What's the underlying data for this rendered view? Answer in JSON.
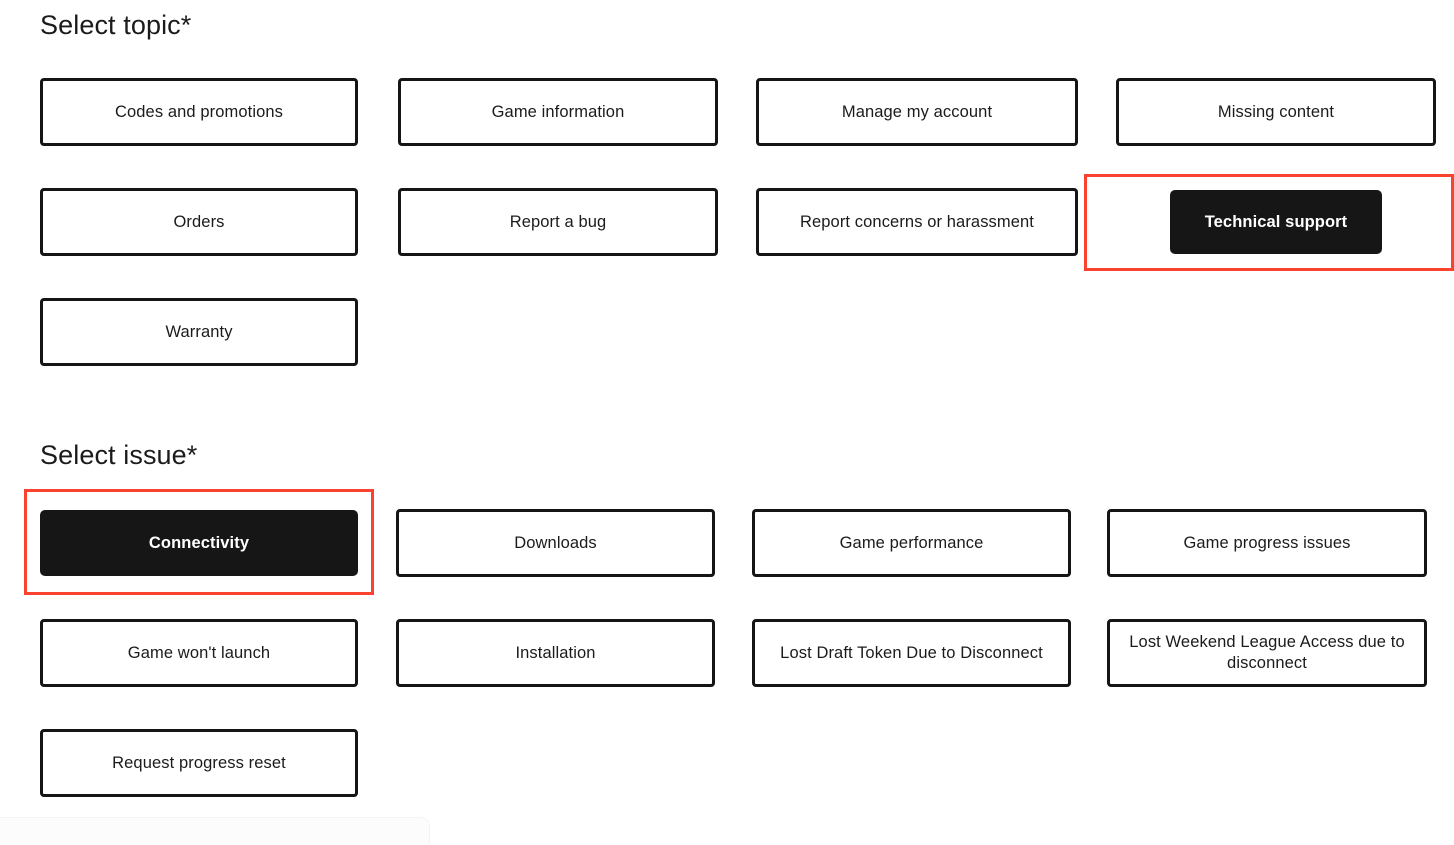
{
  "sections": [
    {
      "id": "topic",
      "heading": "Select topic*",
      "options": [
        {
          "label": "Codes and promotions",
          "selected": false
        },
        {
          "label": "Game information",
          "selected": false
        },
        {
          "label": "Manage my account",
          "selected": false
        },
        {
          "label": "Missing content",
          "selected": false
        },
        {
          "label": "Orders",
          "selected": false
        },
        {
          "label": "Report a bug",
          "selected": false
        },
        {
          "label": "Report concerns or harassment",
          "selected": false
        },
        {
          "label": "Technical support",
          "selected": true
        },
        {
          "label": "Warranty",
          "selected": false
        }
      ]
    },
    {
      "id": "issue",
      "heading": "Select issue*",
      "options": [
        {
          "label": "Connectivity",
          "selected": true
        },
        {
          "label": "Downloads",
          "selected": false
        },
        {
          "label": "Game performance",
          "selected": false
        },
        {
          "label": "Game progress issues",
          "selected": false
        },
        {
          "label": "Game won't launch",
          "selected": false
        },
        {
          "label": "Installation",
          "selected": false
        },
        {
          "label": "Lost Draft Token Due to Disconnect",
          "selected": false
        },
        {
          "label": "Lost Weekend League Access due to disconnect",
          "selected": false
        },
        {
          "label": "Request progress reset",
          "selected": false
        }
      ]
    }
  ],
  "highlights": [
    {
      "target": "Technical support"
    },
    {
      "target": "Connectivity"
    }
  ],
  "colors": {
    "selected_fill": "#161616",
    "selected_text": "#ffffff",
    "button_border": "#151515",
    "highlight_ring": "#f9432f",
    "page_background": "#ffffff",
    "text": "#1b1b1b"
  }
}
